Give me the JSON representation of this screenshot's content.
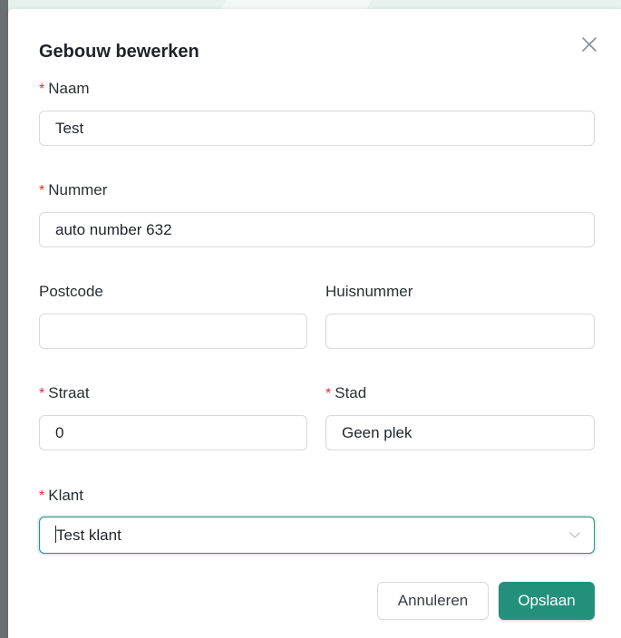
{
  "modal": {
    "title": "Gebouw bewerken",
    "required_mark": "*"
  },
  "fields": {
    "naam": {
      "label": "Naam",
      "value": "Test",
      "required": true
    },
    "nummer": {
      "label": "Nummer",
      "value": "auto number 632",
      "required": true
    },
    "postcode": {
      "label": "Postcode",
      "value": "",
      "required": false
    },
    "huisnummer": {
      "label": "Huisnummer",
      "value": "",
      "required": false
    },
    "straat": {
      "label": "Straat",
      "value": "0",
      "required": true
    },
    "stad": {
      "label": "Stad",
      "value": "Geen plek",
      "required": true
    },
    "klant": {
      "label": "Klant",
      "value": "Test klant",
      "required": true
    }
  },
  "footer": {
    "cancel_label": "Annuleren",
    "save_label": "Opslaan"
  },
  "colors": {
    "primary": "#23907c",
    "required": "#f5222d",
    "border": "#d9d9d9",
    "backdrop": "#e7f1ee"
  },
  "icons": {
    "close": "close-icon",
    "select": "chevron-down-icon"
  }
}
